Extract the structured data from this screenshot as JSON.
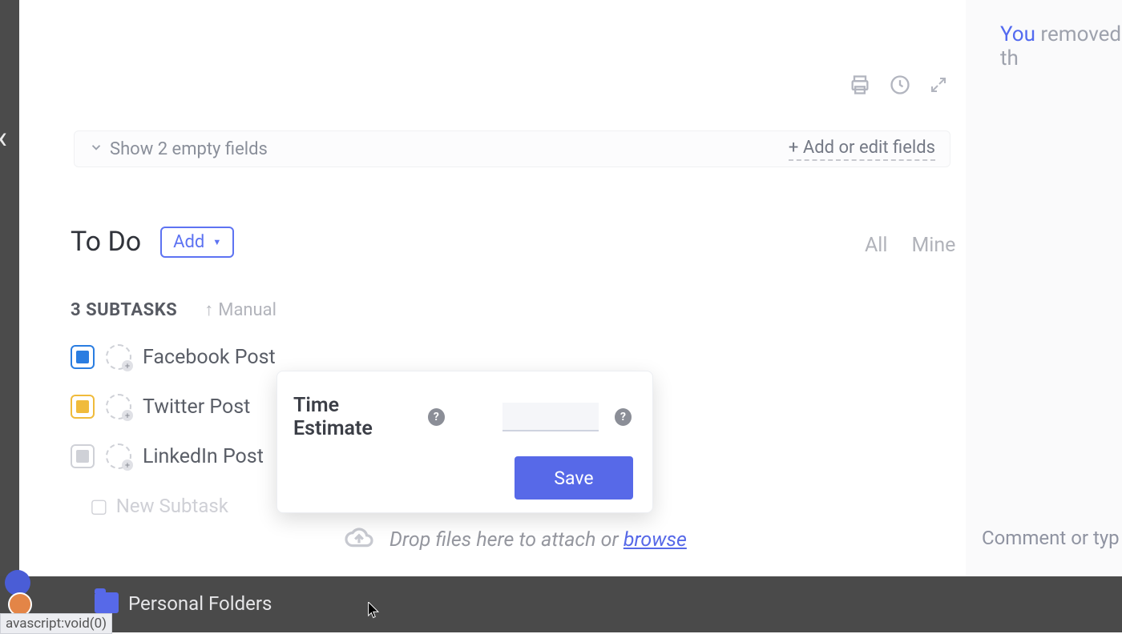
{
  "rightPanel": {
    "you": "You",
    "removed": "removed th",
    "commentPlaceholder": "Comment or typ"
  },
  "actions": {
    "print": "print-icon",
    "history": "history-icon",
    "expand": "expand-icon"
  },
  "fieldsBar": {
    "show": "Show 2 empty fields",
    "addEdit": "+ Add or edit fields"
  },
  "todo": {
    "title": "To Do",
    "addLabel": "Add",
    "filterAll": "All",
    "filterMine": "Mine"
  },
  "subtasksMeta": {
    "count": "3 SUBTASKS",
    "sort": "Manual"
  },
  "subtasks": [
    {
      "name": "Facebook Post",
      "color": "#2a7de1"
    },
    {
      "name": "Twitter Post",
      "color": "#f0bb3b"
    },
    {
      "name": "LinkedIn Post",
      "color": "#cfd1d7"
    }
  ],
  "newSubtask": "New Subtask",
  "popover": {
    "label": "Time Estimate",
    "save": "Save"
  },
  "dropzone": {
    "textA": "Drop files here to attach or ",
    "browse": "browse"
  },
  "bottomBar": {
    "folder": "Personal Folders"
  },
  "status": "avascript:void(0)"
}
